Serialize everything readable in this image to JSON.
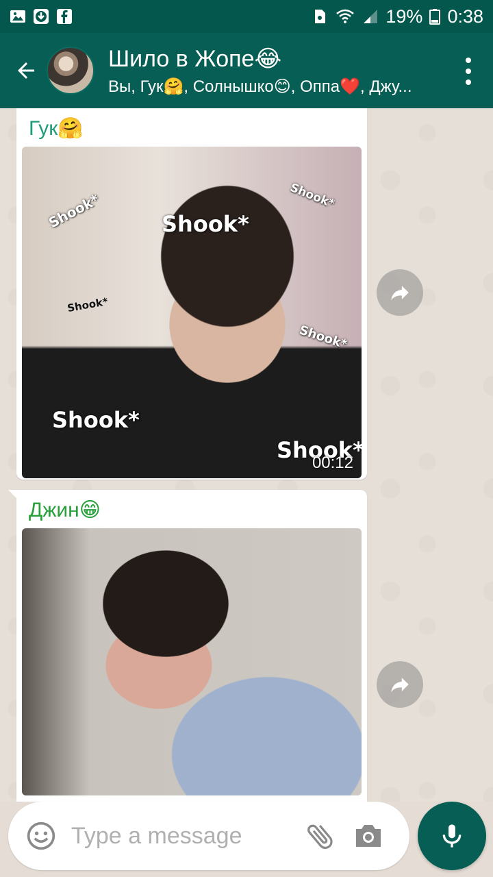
{
  "status_bar": {
    "battery_percent": "19%",
    "time": "0:38"
  },
  "header": {
    "title": "Шило в Жопе😂",
    "subtitle": "Вы, Гук🤗, Солнышко😊, Оппа❤️, Джу..."
  },
  "messages": [
    {
      "sender": "Гук🤗",
      "media_type": "gif",
      "overlay_texts": [
        "Shook*",
        "Shook*",
        "Shook*",
        "Shook*",
        "Shook*",
        "Shook*",
        "Shook*"
      ],
      "duration": "00:12"
    },
    {
      "sender": "Джин😁",
      "media_type": "gif"
    }
  ],
  "composer": {
    "placeholder": "Type a message"
  },
  "colors": {
    "header": "#075e54",
    "status_bar": "#04574c",
    "chat_background": "#e6dfd7",
    "sender1": "#1e9c7a",
    "sender2": "#27a03a"
  }
}
